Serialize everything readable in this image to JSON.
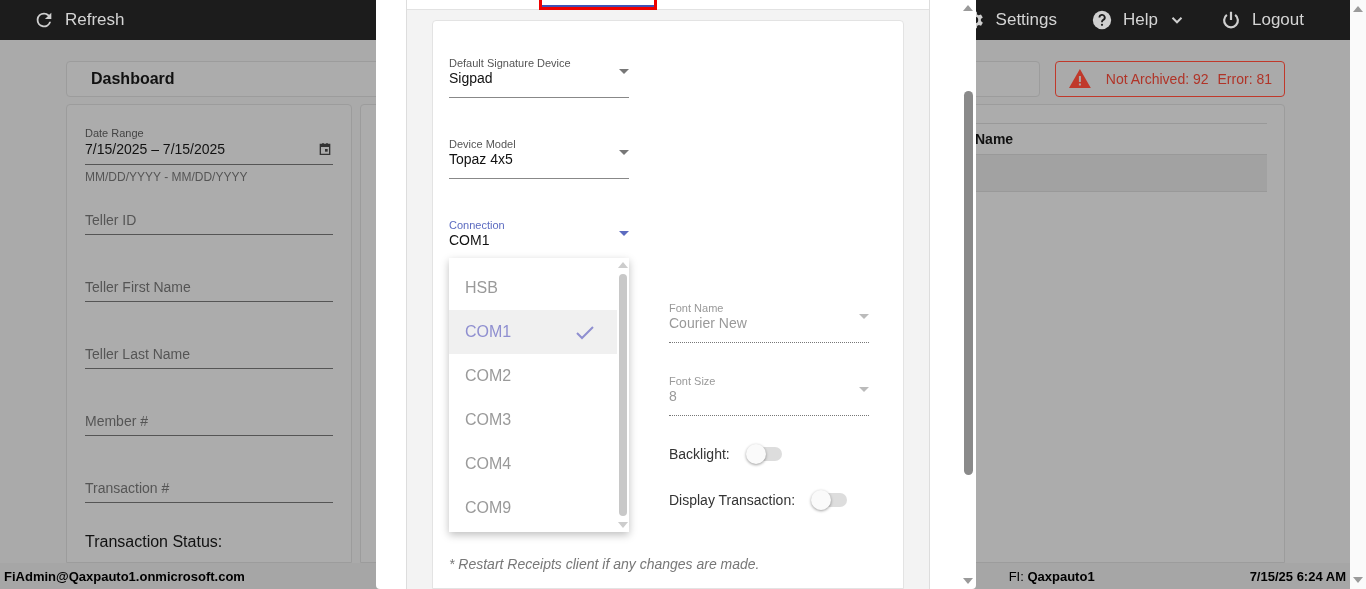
{
  "top_bar": {
    "refresh": "Refresh",
    "settings": "Settings",
    "help": "Help",
    "logout": "Logout"
  },
  "dashboard": {
    "title": "Dashboard",
    "alert": [
      "Not Archived: 92",
      "Error: 81"
    ]
  },
  "filters": {
    "date_range": {
      "label": "Date Range",
      "value": "7/15/2025 – 7/15/2025",
      "hint": "MM/DD/YYYY - MM/DD/YYYY"
    },
    "fields": [
      {
        "placeholder": "Teller ID"
      },
      {
        "placeholder": "Teller First Name"
      },
      {
        "placeholder": "Teller Last Name"
      },
      {
        "placeholder": "Member #"
      },
      {
        "placeholder": "Transaction #"
      }
    ],
    "status_label": "Transaction Status:"
  },
  "table": {
    "columns": [
      "Name"
    ]
  },
  "modal": {
    "tabs": [
      {
        "selected": true
      }
    ],
    "selects": [
      {
        "label": "Default Signature Device",
        "value": "Sigpad",
        "focused": false
      },
      {
        "label": "Device Model",
        "value": "Topaz 4x5",
        "focused": false
      },
      {
        "label": "Connection",
        "value": "COM1",
        "focused": true
      }
    ],
    "dropdown": {
      "options": [
        {
          "label": "HSB",
          "selected": false
        },
        {
          "label": "COM1",
          "selected": true
        },
        {
          "label": "COM2",
          "selected": false
        },
        {
          "label": "COM3",
          "selected": false
        },
        {
          "label": "COM4",
          "selected": false
        },
        {
          "label": "COM9",
          "selected": false
        }
      ]
    },
    "settings": [
      {
        "kind": "select",
        "label": "Font Name",
        "value": "Courier New",
        "disabled": true
      },
      {
        "kind": "select",
        "label": "Font Size",
        "value": "8",
        "disabled": true
      },
      {
        "kind": "toggle",
        "label": "Backlight:",
        "on": false
      },
      {
        "kind": "toggle",
        "label": "Display Transaction:",
        "on": false
      }
    ],
    "note": "* Restart Receipts client if any changes are made."
  },
  "status_bar": {
    "user": "FiAdmin@Qaxpauto1.onmicrosoft.com",
    "fi": "FI: **Qaxpauto1**",
    "time": "7/15/25 6:24 AM"
  }
}
